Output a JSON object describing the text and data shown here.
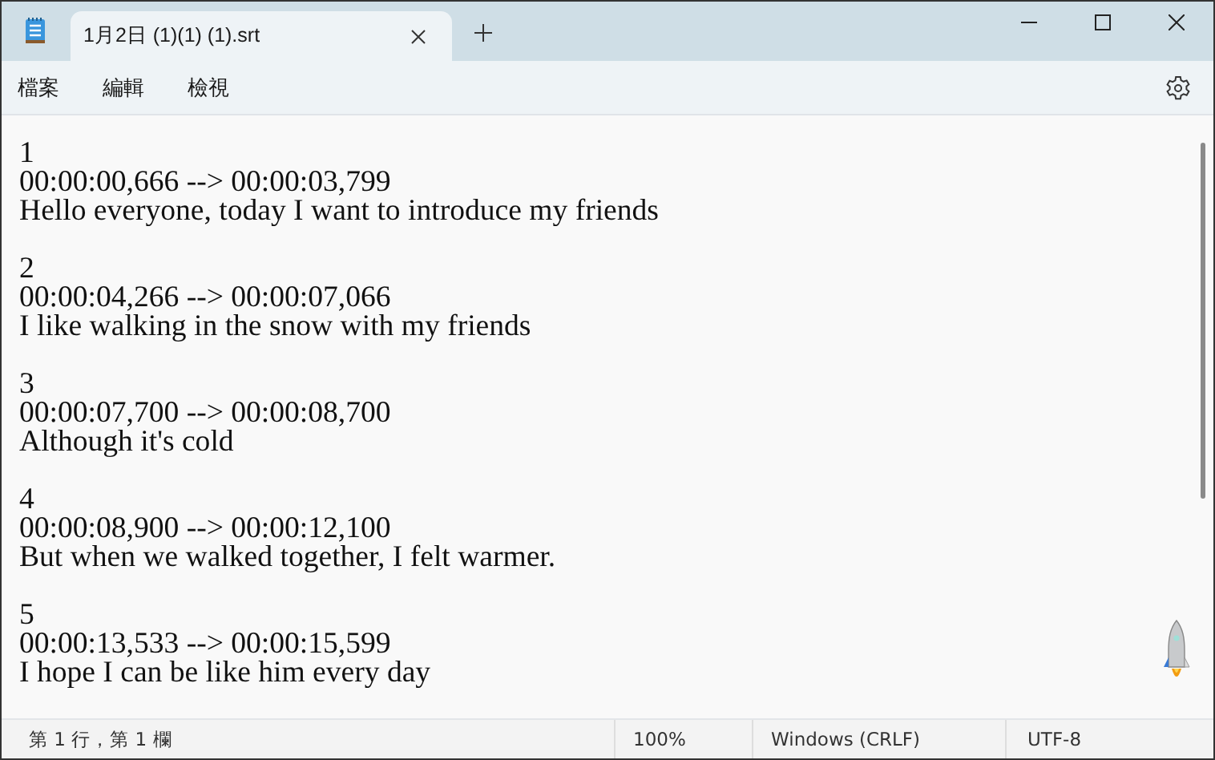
{
  "tab": {
    "title": "1月2日 (1)(1) (1).srt",
    "selected": true
  },
  "menu": [
    "檔案",
    "編輯",
    "檢視"
  ],
  "document": [
    {
      "number": "1",
      "time": "00:00:00,666 --> 00:00:03,799",
      "text": "Hello everyone, today I want to introduce my friends"
    },
    {
      "number": "2",
      "time": "00:00:04,266 --> 00:00:07,066",
      "text": "I like walking in the snow with my friends"
    },
    {
      "number": "3",
      "time": "00:00:07,700 --> 00:00:08,700",
      "text": "Although it's cold"
    },
    {
      "number": "4",
      "time": "00:00:08,900 --> 00:00:12,100",
      "text": "But when we walked together, I felt warmer."
    },
    {
      "number": "5",
      "time": "00:00:13,533 --> 00:00:15,599",
      "text": "I hope I can be like him every day"
    }
  ],
  "status_bar": {
    "position": "第 1 行，第 1 欄",
    "zoom": "100%",
    "line_ending": "Windows (CRLF)",
    "encoding": "UTF-8"
  }
}
